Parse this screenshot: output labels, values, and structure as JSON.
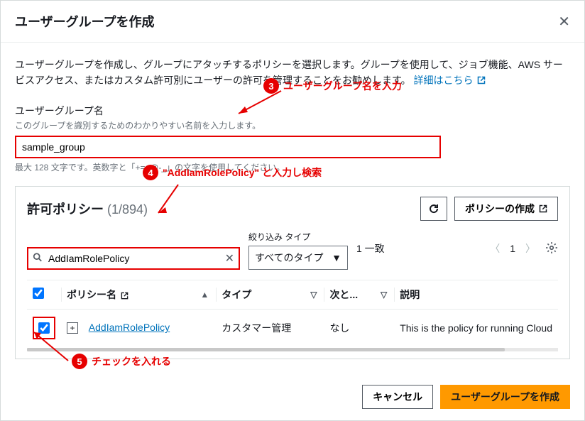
{
  "modal": {
    "title": "ユーザーグループを作成",
    "description_pre": "ユーザーグループを作成し、グループにアタッチするポリシーを選択します。グループを使用して、ジョブ機能、AWS サービスアクセス、またはカスタム許可別にユーザーの許可を管理することをお勧めします。 ",
    "learn_more": "詳細はこちら"
  },
  "group_name": {
    "label": "ユーザーグループ名",
    "hint": "このグループを識別するためのわかりやすい名前を入力します。",
    "value": "sample_group",
    "below": "最大 128 文字です。英数字と「+=,.@-_」の文字を使用してください。"
  },
  "callouts": {
    "c3": "ユーザーグループ名を入力",
    "c4": "\"AddIamRolePolicy\" と入力し検索",
    "c5": "チェックを入れる"
  },
  "policy_panel": {
    "title": "許可ポリシー",
    "count": " (1/894)",
    "create_btn": "ポリシーの作成"
  },
  "filter": {
    "search_value": "AddIamRolePolicy",
    "type_label": "絞り込み タイプ",
    "type_selected": "すべてのタイプ",
    "matches": "1 一致",
    "page": "1"
  },
  "table": {
    "col_policy": "ポリシー名",
    "col_type": "タイプ",
    "col_next": "次と...",
    "col_desc": "説明",
    "row1": {
      "name": "AddIamRolePolicy",
      "type": "カスタマー管理",
      "next": "なし",
      "desc": "This is the policy for running Cloud"
    }
  },
  "footer": {
    "cancel": "キャンセル",
    "submit": "ユーザーグループを作成"
  }
}
